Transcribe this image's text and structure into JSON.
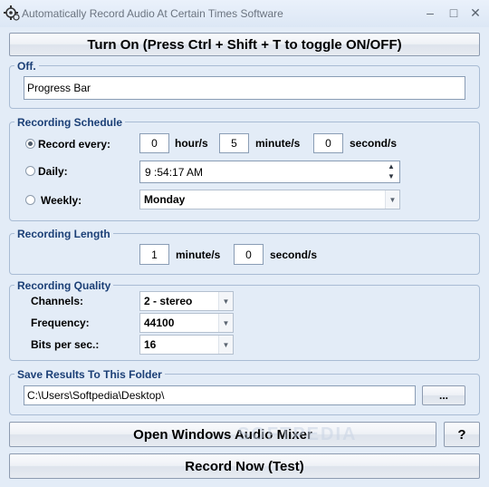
{
  "window": {
    "title": "Automatically Record Audio At Certain Times Software",
    "minimize_glyph": "–",
    "maximize_glyph": "□",
    "close_glyph": "✕",
    "icon": "app-gear-icon"
  },
  "toggle_button": "Turn On (Press Ctrl + Shift + T to toggle ON/OFF)",
  "status": {
    "group_title": "Off.",
    "progress_value": "Progress Bar"
  },
  "schedule": {
    "group_title": "Recording Schedule",
    "selected_mode": "record_every",
    "record_every": {
      "label": "Record every:",
      "hours": "0",
      "hours_unit": "hour/s",
      "minutes": "5",
      "minutes_unit": "minute/s",
      "seconds": "0",
      "seconds_unit": "second/s"
    },
    "daily": {
      "label": "Daily:",
      "time": "9 :54:17 AM"
    },
    "weekly": {
      "label": "Weekly:",
      "day": "Monday"
    }
  },
  "length": {
    "group_title": "Recording Length",
    "minutes": "1",
    "minutes_unit": "minute/s",
    "seconds": "0",
    "seconds_unit": "second/s"
  },
  "quality": {
    "group_title": "Recording Quality",
    "channels_label": "Channels:",
    "channels_value": "2 - stereo",
    "frequency_label": "Frequency:",
    "frequency_value": "44100",
    "bits_label": "Bits per sec.:",
    "bits_value": "16"
  },
  "save": {
    "group_title": "Save Results To This Folder",
    "folder": "C:\\Users\\Softpedia\\Desktop\\",
    "browse_label": "..."
  },
  "mixer_button": "Open Windows Audio Mixer",
  "help_button": "?",
  "record_now_button": "Record Now (Test)",
  "watermark": "SOFTPEDIA",
  "colors": {
    "background": "#e3ecf7",
    "group_title": "#1b3f76",
    "group_border": "#a9bcd4"
  }
}
